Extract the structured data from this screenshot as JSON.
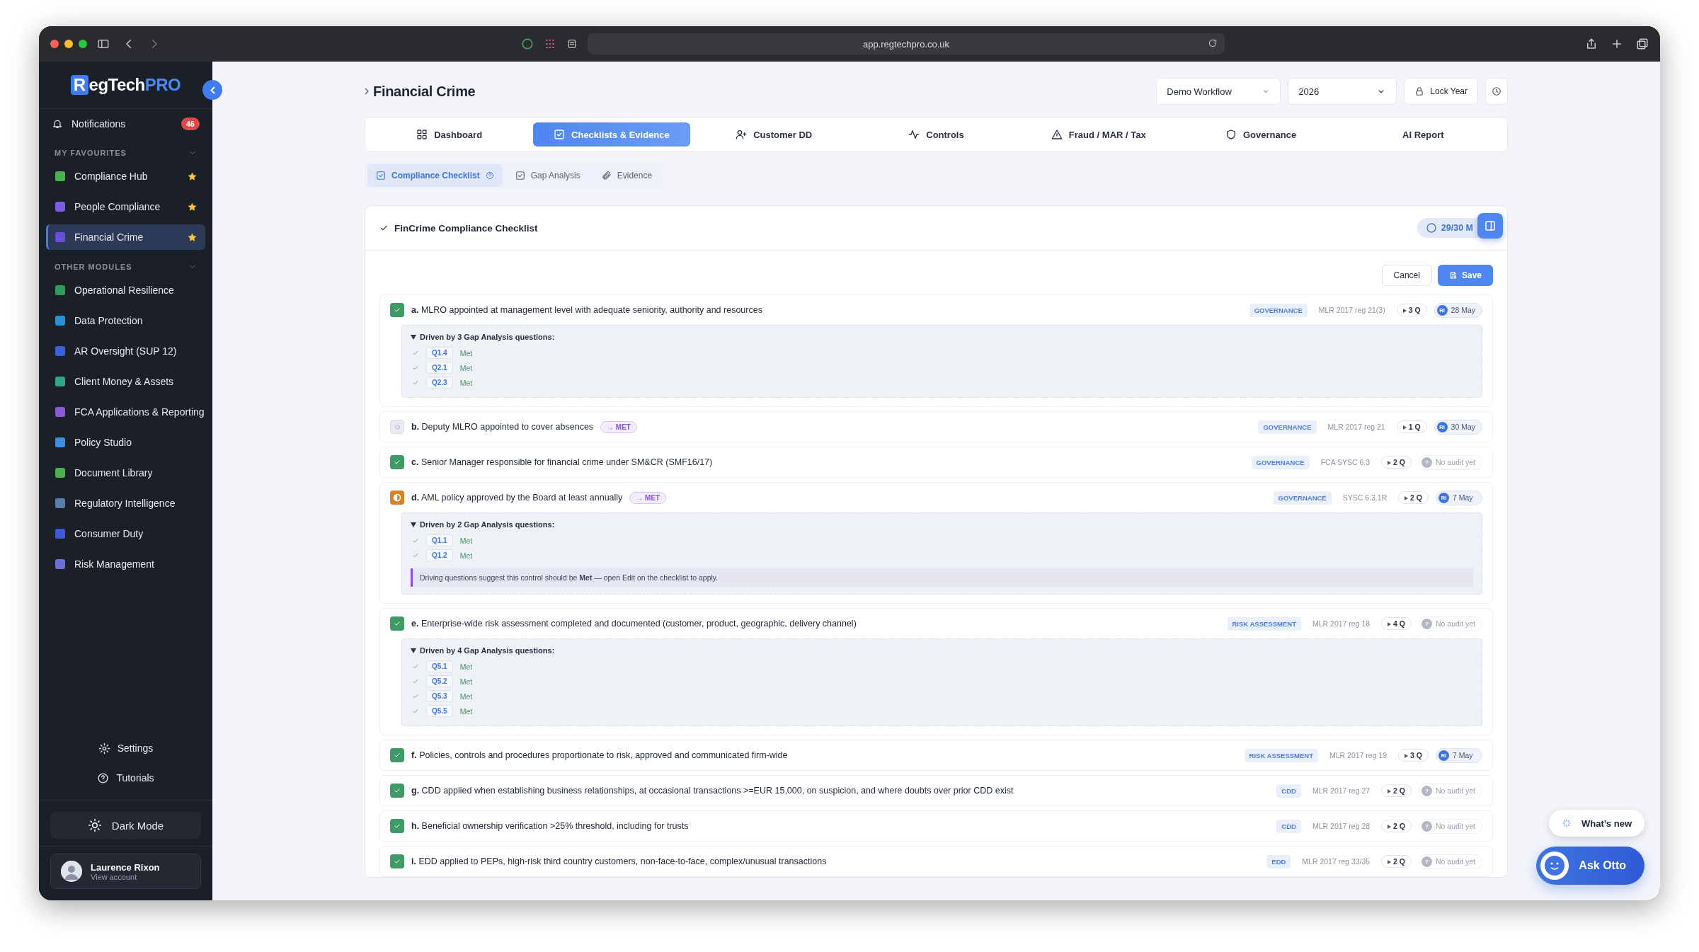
{
  "browser": {
    "url": "app.regtechpro.co.uk"
  },
  "sidebar": {
    "logo": {
      "mark": "R",
      "name": "egTech",
      "accent": "PRO"
    },
    "notifications": {
      "label": "Notifications",
      "count": "46"
    },
    "sections": [
      {
        "title": "MY FAVOURITES",
        "items": [
          {
            "label": "Compliance Hub",
            "starred": true,
            "selected": false,
            "color": "#4caf50"
          },
          {
            "label": "People Compliance",
            "starred": true,
            "selected": false,
            "color": "#7c5ce0"
          },
          {
            "label": "Financial Crime",
            "starred": true,
            "selected": true,
            "color": "#6a4fd8"
          }
        ]
      },
      {
        "title": "OTHER MODULES",
        "items": [
          {
            "label": "Operational Resilience",
            "starred": false,
            "selected": false,
            "color": "#2e9d5b"
          },
          {
            "label": "Data Protection",
            "starred": false,
            "selected": false,
            "color": "#2b8fd6"
          },
          {
            "label": "AR Oversight (SUP 12)",
            "starred": false,
            "selected": false,
            "color": "#3a62d8"
          },
          {
            "label": "Client Money & Assets",
            "starred": false,
            "selected": false,
            "color": "#2fa58c"
          },
          {
            "label": "FCA Applications & Reporting",
            "starred": false,
            "selected": false,
            "color": "#8a5ad8"
          },
          {
            "label": "Policy Studio",
            "starred": false,
            "selected": false,
            "color": "#3d8ee0"
          },
          {
            "label": "Document Library",
            "starred": false,
            "selected": false,
            "color": "#4cae4f"
          },
          {
            "label": "Regulatory Intelligence",
            "starred": false,
            "selected": false,
            "color": "#5a7fa8"
          },
          {
            "label": "Consumer Duty",
            "starred": false,
            "selected": false,
            "color": "#3b5bd9"
          },
          {
            "label": "Risk Management",
            "starred": false,
            "selected": false,
            "color": "#6b6fd8"
          }
        ]
      }
    ],
    "footer": {
      "settings": "Settings",
      "tutorials": "Tutorials",
      "dark_mode": "Dark Mode",
      "user": {
        "name": "Laurence Rixon",
        "subtitle": "View account"
      }
    }
  },
  "header": {
    "title": "Financial Crime",
    "workflow": "Demo Workflow",
    "year": "2026",
    "lock": "Lock Year"
  },
  "tabs": [
    {
      "label": "Dashboard",
      "selected": false
    },
    {
      "label": "Checklists & Evidence",
      "selected": true
    },
    {
      "label": "Customer DD",
      "selected": false
    },
    {
      "label": "Controls",
      "selected": false
    },
    {
      "label": "Fraud / MAR / Tax",
      "selected": false
    },
    {
      "label": "Governance",
      "selected": false
    },
    {
      "label": "AI Report",
      "selected": false
    }
  ],
  "subtabs": [
    {
      "label": "Compliance Checklist",
      "selected": true
    },
    {
      "label": "Gap Analysis",
      "selected": false
    },
    {
      "label": "Evidence",
      "selected": false
    }
  ],
  "checklist": {
    "title": "FinCrime Compliance Checklist",
    "progress": "29/30 M",
    "cancel": "Cancel",
    "save": "Save",
    "items": [
      {
        "letter": "a.",
        "text": "MLRO appointed at management level with adequate seniority, authority and resources",
        "kind": "met",
        "category": "GOVERNANCE",
        "reference": "MLR 2017 reg 21(3)",
        "questions": "3 Q",
        "audit": {
          "kind": "user",
          "initials": "RI",
          "text": "28 May"
        },
        "driven": {
          "title": "Driven by 3 Gap Analysis questions:",
          "questions": [
            {
              "code": "Q1.4",
              "result": "Met"
            },
            {
              "code": "Q2.1",
              "result": "Met"
            },
            {
              "code": "Q2.3",
              "result": "Met"
            }
          ]
        }
      },
      {
        "letter": "b.",
        "text": "Deputy MLRO appointed to cover absences",
        "kind": "pending",
        "badge": "→ MET",
        "category": "GOVERNANCE",
        "reference": "MLR 2017 reg 21",
        "questions": "1 Q",
        "audit": {
          "kind": "user",
          "initials": "RI",
          "text": "30 May"
        }
      },
      {
        "letter": "c.",
        "text": "Senior Manager responsible for financial crime under SM&CR (SMF16/17)",
        "kind": "met",
        "category": "GOVERNANCE",
        "reference": "FCA SYSC 6.3",
        "questions": "2 Q",
        "audit": {
          "kind": "none",
          "initials": "?",
          "text": "No audit yet"
        }
      },
      {
        "letter": "d.",
        "text": "AML policy approved by the Board at least annually",
        "kind": "partial",
        "badge": "→ MET",
        "category": "GOVERNANCE",
        "reference": "SYSC 6.3.1R",
        "questions": "2 Q",
        "audit": {
          "kind": "user",
          "initials": "RI",
          "text": "7 May"
        },
        "driven": {
          "title": "Driven by 2 Gap Analysis questions:",
          "questions": [
            {
              "code": "Q1.1",
              "result": "Met"
            },
            {
              "code": "Q1.2",
              "result": "Met"
            }
          ],
          "note": "Driving questions suggest this control should be **Met** — open Edit on the checklist to apply."
        }
      },
      {
        "letter": "e.",
        "text": "Enterprise-wide risk assessment completed and documented (customer, product, geographic, delivery channel)",
        "kind": "met",
        "category": "RISK ASSESSMENT",
        "reference": "MLR 2017 reg 18",
        "questions": "4 Q",
        "audit": {
          "kind": "none",
          "initials": "?",
          "text": "No audit yet"
        },
        "driven": {
          "title": "Driven by 4 Gap Analysis questions:",
          "questions": [
            {
              "code": "Q5.1",
              "result": "Met"
            },
            {
              "code": "Q5.2",
              "result": "Met"
            },
            {
              "code": "Q5.3",
              "result": "Met"
            },
            {
              "code": "Q5.5",
              "result": "Met"
            }
          ]
        }
      },
      {
        "letter": "f.",
        "text": "Policies, controls and procedures proportionate to risk, approved and communicated firm-wide",
        "kind": "met",
        "category": "RISK ASSESSMENT",
        "reference": "MLR 2017 reg 19",
        "questions": "3 Q",
        "audit": {
          "kind": "user",
          "initials": "RI",
          "text": "7 May"
        }
      },
      {
        "letter": "g.",
        "text": "CDD applied when establishing business relationships, at occasional transactions >=EUR 15,000, on suspicion, and where doubts over prior CDD exist",
        "kind": "met",
        "category": "CDD",
        "reference": "MLR 2017 reg 27",
        "questions": "2 Q",
        "audit": {
          "kind": "none",
          "initials": "?",
          "text": "No audit yet"
        }
      },
      {
        "letter": "h.",
        "text": "Beneficial ownership verification >25% threshold, including for trusts",
        "kind": "met",
        "category": "CDD",
        "reference": "MLR 2017 reg 28",
        "questions": "2 Q",
        "audit": {
          "kind": "none",
          "initials": "?",
          "text": "No audit yet"
        }
      },
      {
        "letter": "i.",
        "text": "EDD applied to PEPs, high-risk third country customers, non-face-to-face, complex/unusual transactions",
        "kind": "met",
        "category": "EDD",
        "reference": "MLR 2017 reg 33/35",
        "questions": "2 Q",
        "audit": {
          "kind": "none",
          "initials": "?",
          "text": "No audit yet"
        }
      }
    ]
  },
  "floating": {
    "whats_new": "What’s new",
    "ask": "Ask Otto"
  }
}
